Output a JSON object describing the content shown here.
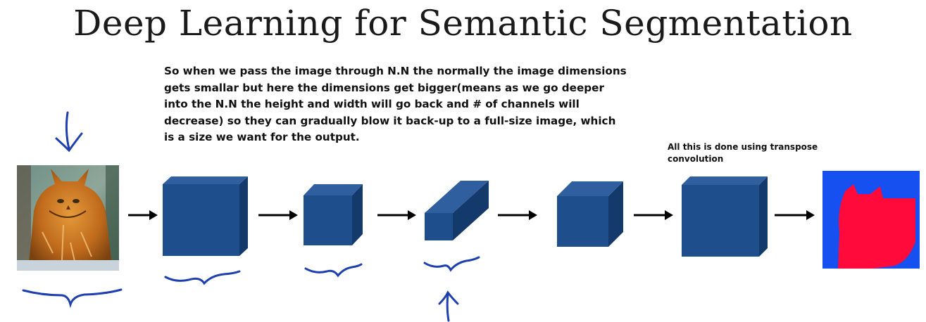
{
  "title": "Deep Learning for Semantic Segmentation",
  "description": "So when we pass the image through N.N the normally the image dimensions gets smallar but here the dimensions get bigger(means as we go deeper into the N.N the height and width will go back and # of channels will decrease) so they can gradually blow it back-up to a full-size image, which is a size we want for the output.",
  "note": "All this is done using transpose convolution",
  "colors": {
    "box_front": "#1f4e8c",
    "box_top": "#2f5f9e",
    "box_side": "#143a6b",
    "ink": "#1d3fb0",
    "mask_background": "#1750f0",
    "mask_cat": "#ff0a3a"
  },
  "icons": [
    "cat-input-image",
    "segmentation-mask-output",
    "arrow-right-icon",
    "handwritten-arrow-icon",
    "handwritten-brace-icon"
  ]
}
